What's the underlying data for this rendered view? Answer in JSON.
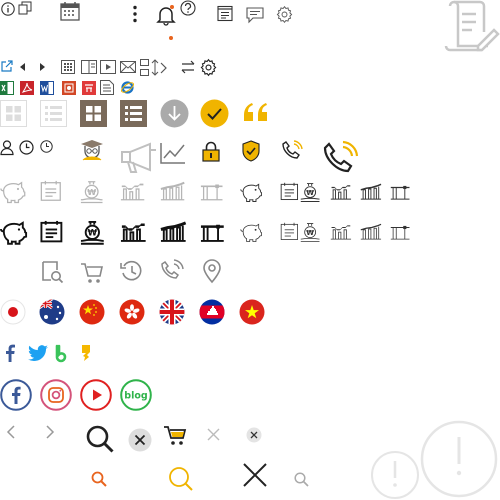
{
  "colors": {
    "dark": "#222222",
    "mid": "#555555",
    "grey": "#999999",
    "lightgrey": "#c8c8c8",
    "gold": "#f0b400",
    "orange": "#e8641e",
    "facebook": "#3b5998",
    "twitter": "#1da1f2",
    "instagram": "#d4537a",
    "youtube": "#e02020",
    "blog": "#2fb34a"
  },
  "sprite": {
    "social_blog_text": "blog",
    "won_symbol": "₩"
  },
  "icons": [
    "info-icon",
    "copy-icon",
    "calendar-icon",
    "more-vertical-icon",
    "notification-bell-icon",
    "help-icon",
    "notepad-icon",
    "chat-bubble-icon",
    "settings-gear-icon",
    "document-scroll-icon",
    "external-link-icon",
    "arrow-left-small-icon",
    "arrow-right-small-icon",
    "calculator-icon",
    "book-icon",
    "video-play-icon",
    "mail-icon",
    "sort-icon",
    "chevron-right-icon",
    "swap-arrows-icon",
    "gear-icon",
    "excel-file-icon",
    "pdf-file-icon",
    "word-file-icon",
    "powerpoint-file-icon",
    "hwp-file-icon",
    "text-file-icon",
    "ie-browser-icon",
    "grid-view-light-icon",
    "list-view-light-icon",
    "grid-view-dark-icon",
    "list-view-dark-icon",
    "download-circle-icon",
    "check-circle-icon",
    "quote-icon",
    "user-icon",
    "clock-icon",
    "clock-small-icon",
    "graduate-icon",
    "megaphone-icon",
    "line-chart-icon",
    "lock-icon",
    "shield-check-icon",
    "phone-call-icon",
    "phone-call-large-icon",
    "piggy-bank-icon",
    "ledger-icon",
    "coin-hand-icon",
    "bar-chart-icon",
    "bar-chart-up-icon",
    "min-max-chart-icon",
    "search-doc-icon",
    "cart-icon",
    "history-icon",
    "phone-history-icon",
    "location-pin-icon",
    "japan-flag-icon",
    "australia-flag-icon",
    "china-flag-icon",
    "hong-kong-flag-icon",
    "uk-flag-icon",
    "cambodia-flag-icon",
    "vietnam-flag-icon",
    "facebook-icon",
    "twitter-icon",
    "band-icon",
    "kakaostory-icon",
    "facebook-circle-icon",
    "instagram-circle-icon",
    "youtube-circle-icon",
    "blog-circle-icon",
    "arrow-left-icon",
    "arrow-right-icon",
    "search-large-icon",
    "close-circle-icon",
    "cart-gold-icon",
    "close-light-icon",
    "close-small-circle-icon",
    "alert-circle-large-icon",
    "alert-circle-icon",
    "search-orange-icon",
    "search-gold-icon",
    "close-large-icon",
    "search-small-icon"
  ]
}
